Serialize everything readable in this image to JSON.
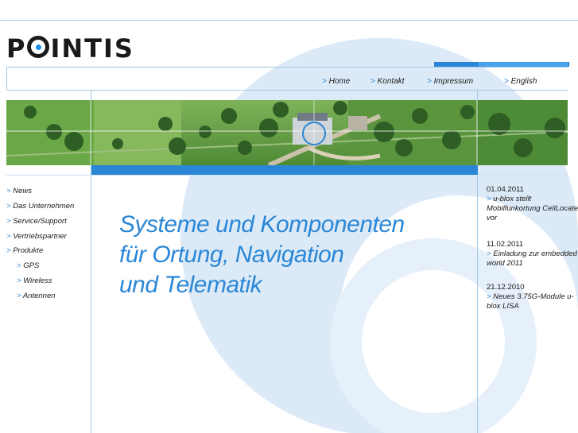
{
  "brand": {
    "logo_text_before": "P",
    "logo_text_after": "INTIS"
  },
  "nav": {
    "items": [
      {
        "label": "Home"
      },
      {
        "label": "Kontakt"
      },
      {
        "label": "Impressum"
      },
      {
        "label": "English"
      }
    ],
    "arrow": ">"
  },
  "menu": {
    "items": [
      {
        "label": "News"
      },
      {
        "label": "Das Unternehmen"
      },
      {
        "label": "Service/Support"
      },
      {
        "label": "Vertriebspartner"
      },
      {
        "label": "Produkte"
      }
    ],
    "subitems": [
      {
        "label": "GPS"
      },
      {
        "label": "Wireless"
      },
      {
        "label": "Antennen"
      }
    ]
  },
  "headline": {
    "line1": "Systeme und Komponenten",
    "line2": "für Ortung, Navigation",
    "line3": "und Telematik"
  },
  "news": [
    {
      "date": "01.04.2011",
      "line1": "u-blox stellt",
      "line2": "Mobilfunkortung CellLocate",
      "line3": "vor"
    },
    {
      "date": "11.02.2011",
      "line1": "Einladung zur embedded",
      "line2": "world 2011"
    },
    {
      "date": "21.12.2010",
      "line1": "Neues 3.75G-Module u-",
      "line2": "blox LISA"
    }
  ],
  "colors": {
    "accent": "#2b87d6",
    "line": "#9fc8e6",
    "watermark": "#dceaf7"
  }
}
